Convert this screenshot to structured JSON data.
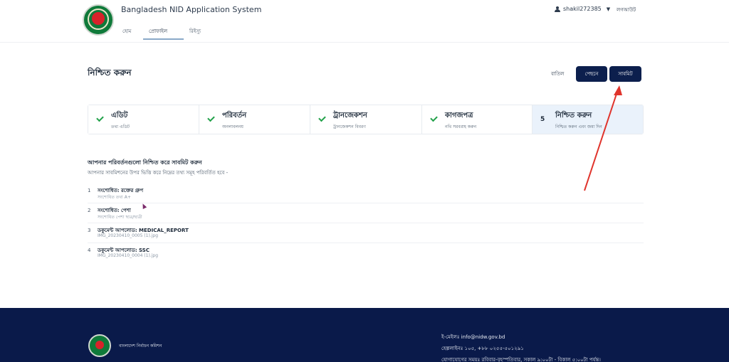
{
  "header": {
    "app_title": "Bangladesh NID Application System",
    "username": "shakil272385",
    "logout_label": "লগআউট"
  },
  "nav": {
    "tabs": [
      {
        "label": "হোম"
      },
      {
        "label": "প্রোফাইল"
      },
      {
        "label": "রিইস্যু"
      }
    ],
    "active_index": 1
  },
  "page": {
    "title": "নিশ্চিত করুন",
    "cancel_label": "বাতিল",
    "back_label": "পেছনে",
    "submit_label": "সাবমিট"
  },
  "steps": [
    {
      "title": "এডিট",
      "subtitle": "তথ্য এডিট",
      "status": "done"
    },
    {
      "title": "পরিবর্তন",
      "subtitle": "অনলাবলনয়",
      "status": "done"
    },
    {
      "title": "ট্রানজেকশন",
      "subtitle": "ট্রানজেকশন বিবরণ",
      "status": "done"
    },
    {
      "title": "কাগজপত্র",
      "subtitle": "নথি সরবরাহ করুন",
      "status": "done"
    },
    {
      "number": "5",
      "title": "নিশ্চিত করুন",
      "subtitle": "নিশ্চিত করুন এবং জমা দিন",
      "status": "current"
    }
  ],
  "summary": {
    "title": "আপনার পরিবর্তনগুলো নিশ্চিত করে সাবমিট করুন",
    "subtitle": "আপনার সাবমিশনের উপর ভিত্তি করে নিম্নের তথ্য সমূহ পরিবর্তিত হবে -",
    "items": [
      {
        "index": "1",
        "main": "সংশোধিত: রক্তের গ্রুপ",
        "sub": "সংশোধিত তথ্য A+"
      },
      {
        "index": "2",
        "main": "সংশোধিত: পেশা",
        "sub": "সংশোধিত পেশা ছাত্র/ছাত্রী"
      },
      {
        "index": "3",
        "main": "ডকুমেন্ট আপলোড: MEDICAL_REPORT",
        "sub": "IMG_20230410_0005 (1).jpg"
      },
      {
        "index": "4",
        "main": "ডকুমেন্ট আপলোড: SSC",
        "sub": "IMG_20230410_0004 (1).jpg"
      }
    ]
  },
  "footer": {
    "org_name": "বাংলাদেশ নির্বাচন কমিশন",
    "email": "ই-মেইলঃ info@nidw.gov.bd",
    "phone": "হেল্পলাইনঃ ১০৫, +৮৮ ০২৫৫-৫০১২৯১",
    "hours": "যোগাযোগের সময়ঃ রবিবার-বৃহস্পতিবার, সকাল ৯:০০টা - বিকাল ৫:০০টা পর্যন্ত।"
  },
  "colors": {
    "primary_button": "#0c1f4d",
    "footer_bg": "#0a1a4a",
    "check_green": "#22a14a",
    "annotation_arrow": "#e0342c"
  }
}
